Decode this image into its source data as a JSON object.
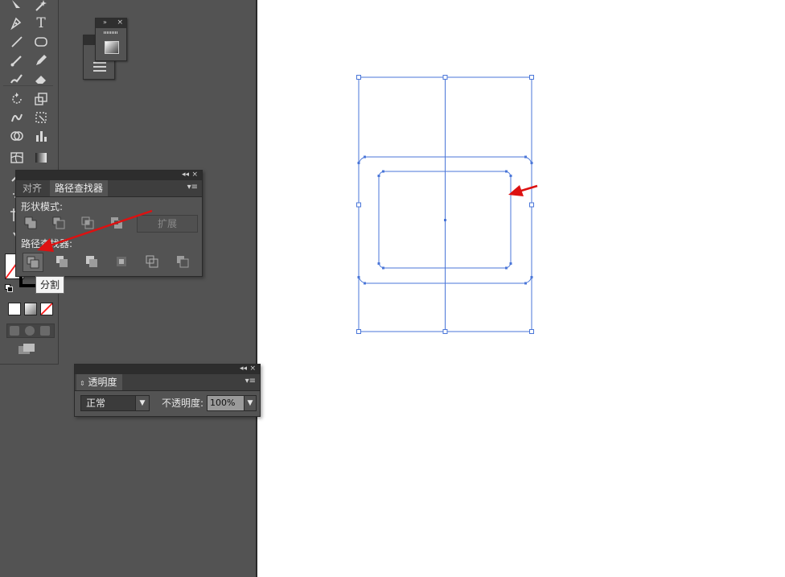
{
  "pathfinder_panel": {
    "tabs": [
      {
        "label": "对齐",
        "active": false
      },
      {
        "label": "路径查找器",
        "active": true
      }
    ],
    "shape_modes_label": "形状模式:",
    "shape_mode_buttons": [
      "unite-icon",
      "minus-front-icon",
      "intersect-icon",
      "exclude-icon"
    ],
    "expand_label": "扩展",
    "pathfinders_label": "路径查找器:",
    "pathfinder_buttons": [
      "divide-icon",
      "trim-icon",
      "merge-icon",
      "crop-icon",
      "outline-icon",
      "minus-back-icon"
    ],
    "tooltip": "分割"
  },
  "transparency_panel": {
    "title": "透明度",
    "blend_mode": "正常",
    "opacity_label": "不透明度:",
    "opacity_value": "100%"
  },
  "tools_panel": {
    "type_tool_glyph": "T"
  },
  "colors": {
    "workspace": "#535353",
    "panel": "#535353",
    "selection": "#4a76d8",
    "annotation_arrow": "#dd1111"
  }
}
